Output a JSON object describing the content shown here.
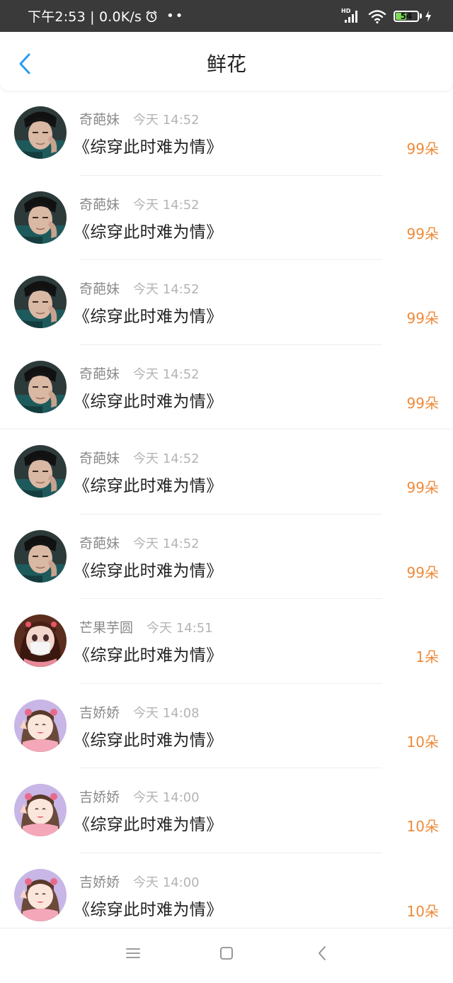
{
  "status_bar": {
    "time": "下午2:53 | 0.0K/s",
    "signal_label": "HD",
    "battery_level": "54",
    "battery_percent": 54,
    "icons": [
      "alarm-icon",
      "more-dots-icon",
      "signal-icon",
      "wifi-icon",
      "battery-icon",
      "charging-icon"
    ]
  },
  "header": {
    "title": "鲜花",
    "back_icon": "chevron-left-icon"
  },
  "colors": {
    "accent": "#2a9bf0",
    "count": "#ee8a3a",
    "username": "#8a8a8a",
    "timestamp": "#b4b4b4",
    "status_bar_bg": "#3a3a3a",
    "battery_green": "#7ed957"
  },
  "items": [
    {
      "avatar": "male-portrait-avatar",
      "user": "奇葩妹",
      "time": "今天 14:52",
      "title": "《综穿此时难为情》",
      "count": "99朵"
    },
    {
      "avatar": "male-portrait-avatar",
      "user": "奇葩妹",
      "time": "今天 14:52",
      "title": "《综穿此时难为情》",
      "count": "99朵"
    },
    {
      "avatar": "male-portrait-avatar",
      "user": "奇葩妹",
      "time": "今天 14:52",
      "title": "《综穿此时难为情》",
      "count": "99朵"
    },
    {
      "avatar": "male-portrait-avatar",
      "user": "奇葩妹",
      "time": "今天 14:52",
      "title": "《综穿此时难为情》",
      "count": "99朵"
    },
    {
      "avatar": "male-portrait-avatar",
      "user": "奇葩妹",
      "time": "今天 14:52",
      "title": "《综穿此时难为情》",
      "count": "99朵"
    },
    {
      "avatar": "male-portrait-avatar",
      "user": "奇葩妹",
      "time": "今天 14:52",
      "title": "《综穿此时难为情》",
      "count": "99朵"
    },
    {
      "avatar": "anime-girl-mask-avatar",
      "user": "芒果芋圆",
      "time": "今天 14:51",
      "title": "《综穿此时难为情》",
      "count": "1朵"
    },
    {
      "avatar": "anime-girl-pink-avatar",
      "user": "吉娇娇",
      "time": "今天 14:08",
      "title": "《综穿此时难为情》",
      "count": "10朵"
    },
    {
      "avatar": "anime-girl-pink-avatar",
      "user": "吉娇娇",
      "time": "今天 14:00",
      "title": "《综穿此时难为情》",
      "count": "10朵"
    },
    {
      "avatar": "anime-girl-pink-avatar",
      "user": "吉娇娇",
      "time": "今天 14:00",
      "title": "《综穿此时难为情》",
      "count": "10朵"
    }
  ],
  "nav_bar": {
    "icons": [
      "menu-icon",
      "home-icon",
      "back-icon"
    ]
  }
}
